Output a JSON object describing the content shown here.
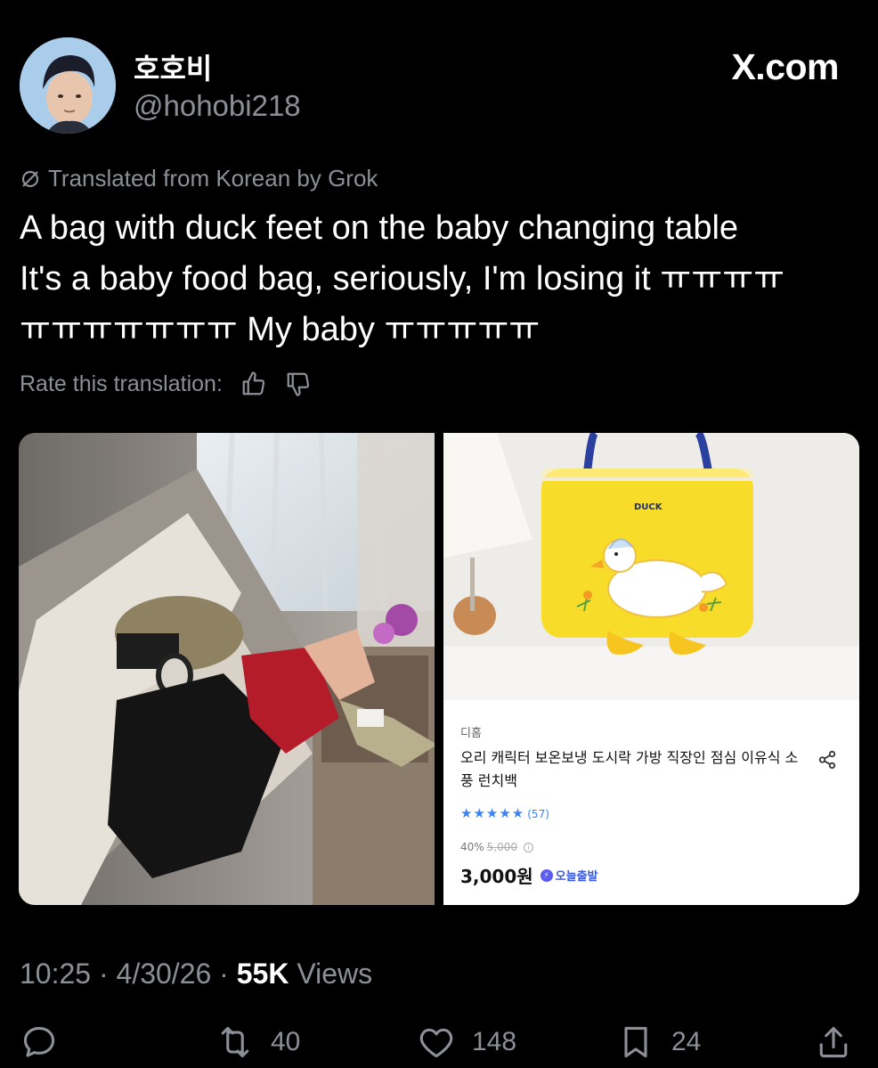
{
  "author": {
    "display_name": "호호비",
    "handle": "@hohobi218"
  },
  "brand": "X.com",
  "translation_notice": "Translated from Korean by Grok",
  "tweet_lines": [
    "A bag with duck feet on the baby changing table",
    "It's a baby food bag, seriously, I'm losing it ㅠㅠㅠㅠ",
    "ㅠㅠㅠㅠㅠㅠㅠ My baby ㅠㅠㅠㅠㅠ"
  ],
  "rate_label": "Rate this translation:",
  "product": {
    "bag_label": "DUCK",
    "seller": "디홈",
    "title": "오리 캐릭터 보온보냉 도시락 가방 직장인 점심 이유식 소풍 런치백",
    "stars": "★★★★★",
    "review_count": "(57)",
    "discount": "40%",
    "original_price": "5,000",
    "price": "3,000원",
    "badge": "오늘출발"
  },
  "meta": {
    "time": "10:25",
    "date": "4/30/26",
    "views_count": "55K",
    "views_label": "Views"
  },
  "actions": {
    "retweets": "40",
    "likes": "148",
    "bookmarks": "24"
  },
  "colors": {
    "background": "#000000",
    "text": "#ffffff",
    "muted": "#8b9097",
    "bag_yellow": "#f7dd2a",
    "handle_blue": "#2b3f9e"
  }
}
